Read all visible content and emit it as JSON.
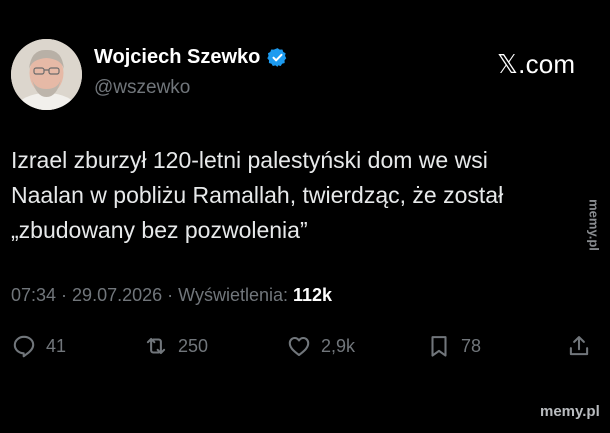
{
  "author": {
    "name": "Wojciech Szewko",
    "handle": "@wszewko",
    "verified": true,
    "verified_color": "#1d9bf0"
  },
  "brand": {
    "label": "𝕏.com",
    "icon": "x-logo"
  },
  "tweet": {
    "lines": [
      "Izrael zburzył 120-letni palestyński dom we wsi",
      "Naalan w pobliżu Ramallah, twierdząc, że został",
      "„zbudowany bez pozwolenia”"
    ]
  },
  "meta": {
    "time": "07:34",
    "sep1": " · ",
    "date": "29.07.2026",
    "sep2": " · ",
    "views_label": "Wyświetlenia: ",
    "views_value": "112k"
  },
  "actions": {
    "reply": {
      "icon": "reply-icon",
      "count": "41"
    },
    "retweet": {
      "icon": "retweet-icon",
      "count": "250"
    },
    "like": {
      "icon": "heart-icon",
      "count": "2,9k"
    },
    "bookmark": {
      "icon": "bookmark-icon",
      "count": "78"
    },
    "share": {
      "icon": "share-icon"
    }
  },
  "watermarks": {
    "side": "memy.pl",
    "footer": "memy.pl"
  },
  "colors": {
    "background": "#000000",
    "text": "#e7e9ea",
    "muted": "#71767b"
  }
}
